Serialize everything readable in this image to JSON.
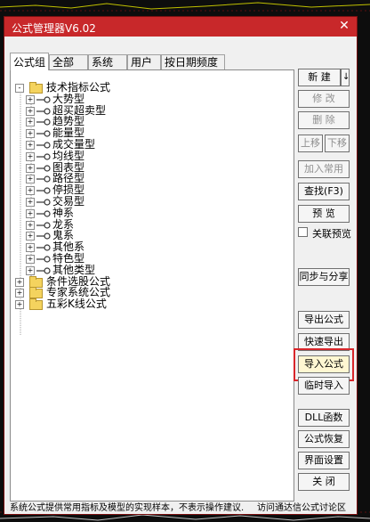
{
  "window": {
    "title": "公式管理器V6.02"
  },
  "tabs": [
    {
      "label": "公式组",
      "active": true
    },
    {
      "label": "全部",
      "active": false
    },
    {
      "label": "系统",
      "active": false
    },
    {
      "label": "用户",
      "active": false
    },
    {
      "label": "按日期频度",
      "active": false
    }
  ],
  "tree": {
    "root_expanded": {
      "label": "技术指标公式"
    },
    "children": [
      {
        "label": "大势型"
      },
      {
        "label": "超买超卖型"
      },
      {
        "label": "趋势型"
      },
      {
        "label": "能量型"
      },
      {
        "label": "成交量型"
      },
      {
        "label": "均线型"
      },
      {
        "label": "图表型"
      },
      {
        "label": "路径型"
      },
      {
        "label": "停损型"
      },
      {
        "label": "交易型"
      },
      {
        "label": "神系"
      },
      {
        "label": "龙系"
      },
      {
        "label": "鬼系"
      },
      {
        "label": "其他系"
      },
      {
        "label": "特色型"
      },
      {
        "label": "其他类型"
      }
    ],
    "roots_collapsed": [
      {
        "label": "条件选股公式"
      },
      {
        "label": "专家系统公式"
      },
      {
        "label": "五彩K线公式"
      }
    ]
  },
  "buttons": {
    "new": "新 建",
    "modify": "修 改",
    "delete": "删 除",
    "move_up": "上移",
    "move_down": "下移",
    "add_common": "加入常用",
    "find": "查找(F3)",
    "preview": "预 览",
    "linked_preview": "关联预览",
    "sync_share": "同步与分享",
    "export": "导出公式",
    "quick_export": "快速导出",
    "import": "导入公式",
    "temp_import": "临时导入",
    "dll": "DLL函数",
    "restore": "公式恢复",
    "ui_settings": "界面设置",
    "close": "关 闭"
  },
  "status": {
    "text": "系统公式提供常用指标及模型的实现样本，不表示操作建议.",
    "link": "访问通达信公式讨论区"
  },
  "colors": {
    "titlebar": "#c8282a",
    "highlight": "#d9262b",
    "folder": "#f4d35e"
  }
}
